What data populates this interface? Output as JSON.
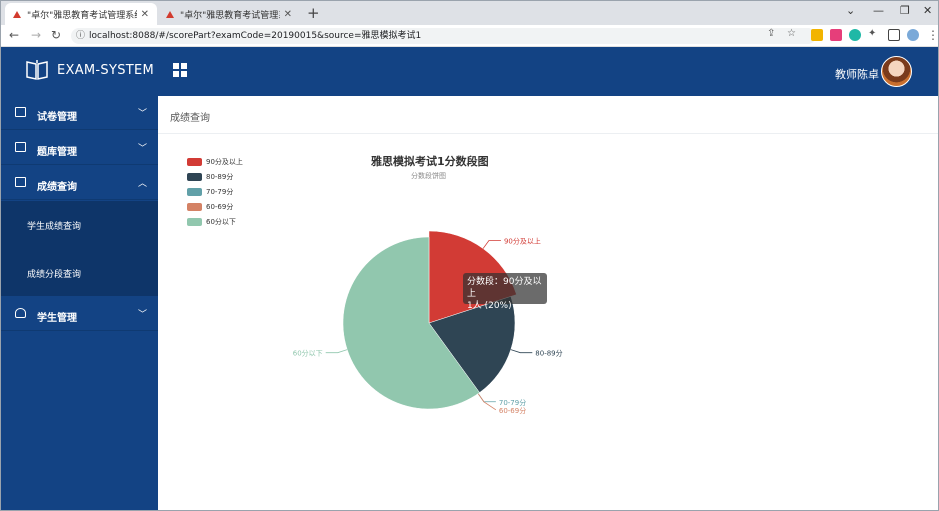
{
  "browser": {
    "tabs": [
      {
        "title": "\"卓尔\"雅思教育考试管理系统",
        "active": true
      },
      {
        "title": "\"卓尔\"雅思教育考试管理系统",
        "active": false
      }
    ],
    "url": "localhost:8088/#/scorePart?examCode=20190015&source=雅思模拟考试1"
  },
  "header": {
    "logo_text": "EXAM-SYSTEM",
    "username": "教师陈卓",
    "color": "#134384"
  },
  "sidebar": {
    "items": [
      {
        "label": "试卷管理",
        "icon": "paper-icon",
        "chevron": "﹀"
      },
      {
        "label": "题库管理",
        "icon": "question-bank-icon",
        "chevron": "﹀"
      },
      {
        "label": "成绩查询",
        "icon": "score-icon",
        "chevron": "︿",
        "children": [
          "学生成绩查询",
          "成绩分段查询"
        ]
      },
      {
        "label": "学生管理",
        "icon": "student-icon",
        "chevron": "﹀"
      }
    ]
  },
  "breadcrumb": "成绩查询",
  "chart_data": {
    "type": "pie",
    "title": "雅思模拟考试1分数段图",
    "subtitle": "分数段饼图",
    "categories": [
      "90分及以上",
      "80-89分",
      "70-79分",
      "60-69分",
      "60分以下"
    ],
    "values": [
      1,
      1,
      0,
      0,
      3
    ],
    "colors": [
      "#d23b35",
      "#2f4554",
      "#61a0a8",
      "#d48265",
      "#91c7ae"
    ],
    "legend": "top-left",
    "tooltip": {
      "line1": "分数段：90分及以上",
      "line2": "1人 (20%)"
    }
  }
}
